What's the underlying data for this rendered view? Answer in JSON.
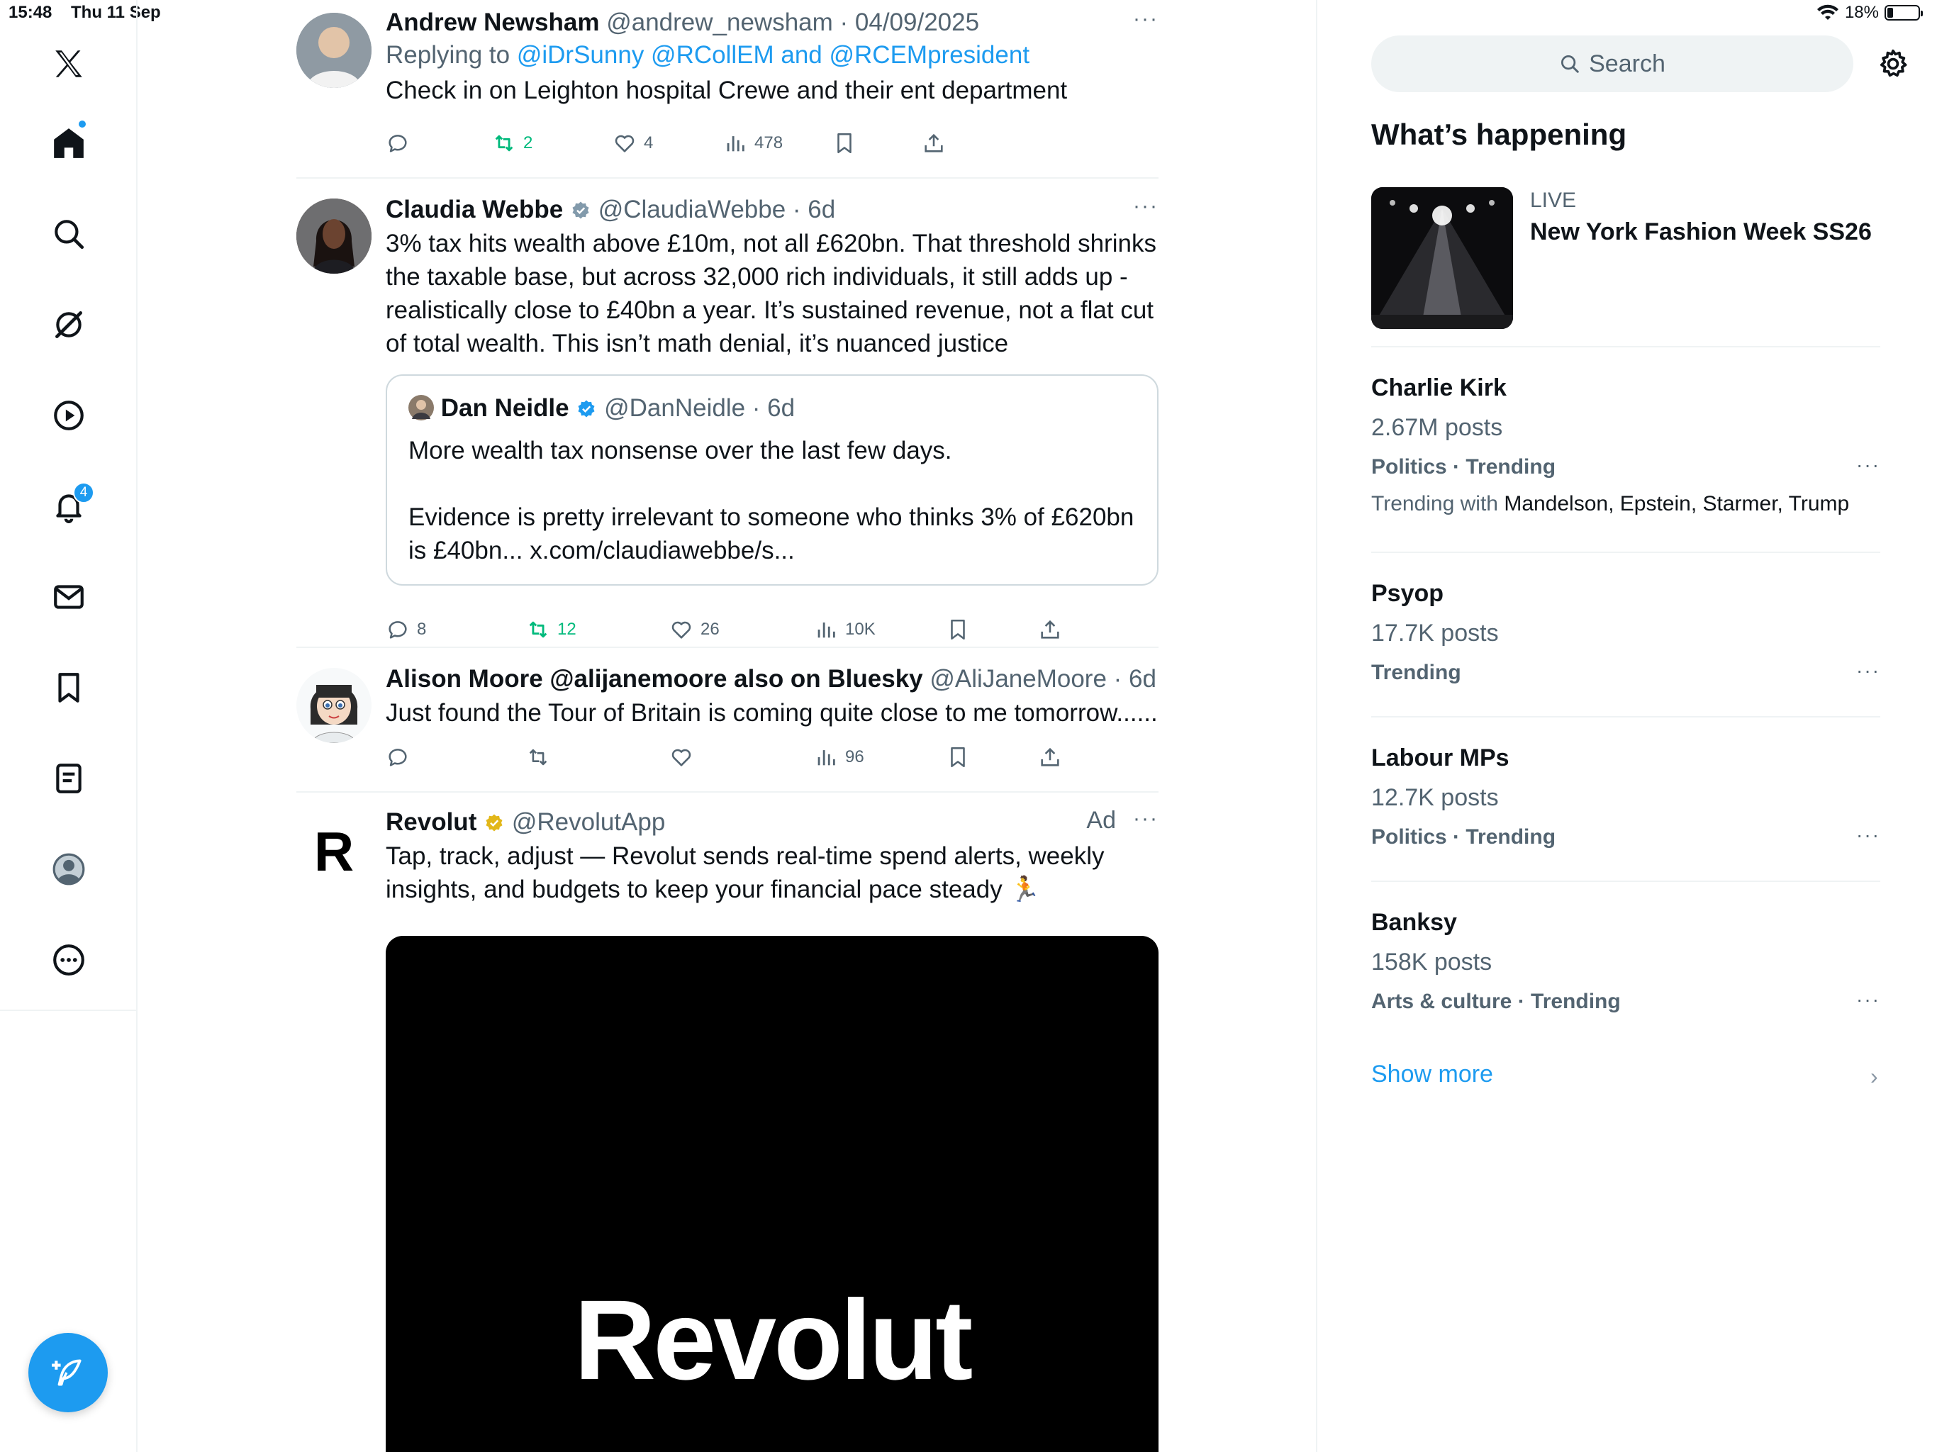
{
  "status_bar": {
    "time": "15:48",
    "date": "Thu 11 Sep",
    "battery": "18%",
    "battery_level": 0.18
  },
  "nav": {
    "notifications_badge": "4"
  },
  "tweets": [
    {
      "name": "Andrew Newsham",
      "handle": "@andrew_newsham",
      "date": "04/09/2025",
      "replying_prefix": "Replying to",
      "replying_to": "@iDrSunny @RCollEM and @RCEMpresident",
      "text": "Check in on Leighton hospital Crewe and their ent department",
      "replies": "",
      "retweets": "2",
      "likes": "4",
      "views": "478"
    },
    {
      "name": "Claudia Webbe",
      "handle": "@ClaudiaWebbe",
      "date": "6d",
      "text": "3% tax hits wealth above £10m, not all £620bn. That threshold shrinks the taxable base, but across 32,000 rich individuals, it still adds up - realistically close to £40bn a year. It’s sustained revenue, not a flat cut of total wealth. This isn’t math denial, it’s nuanced justice",
      "quote": {
        "name": "Dan Neidle",
        "handle": "@DanNeidle",
        "date": "6d",
        "line1": "More wealth tax nonsense over the last few days.",
        "line2": "Evidence is pretty irrelevant to someone who thinks 3% of £620bn is £40bn... x.com/claudiawebbe/s..."
      },
      "replies": "8",
      "retweets": "12",
      "likes": "26",
      "views": "10K"
    },
    {
      "name": "Alison Moore @alijanemoore also on Bluesky",
      "handle": "@AliJaneMoore",
      "date": "6d",
      "text": "Just found the Tour of Britain is coming quite close to me tomorrow......",
      "views": "96"
    },
    {
      "name": "Revolut",
      "handle": "@RevolutApp",
      "ad_label": "Ad",
      "text": "Tap, track, adjust — Revolut sends real-time spend alerts, weekly insights, and budgets to keep your financial pace steady 🏃",
      "media_logo": "Revolut"
    }
  ],
  "sidebar": {
    "search_placeholder": "Search",
    "section_title": "What’s happening",
    "live": {
      "label": "LIVE",
      "title": "New York Fashion Week SS26"
    },
    "trends": [
      {
        "name": "Charlie Kirk",
        "count": "2.67M posts",
        "category": "Politics · Trending",
        "with_prefix": "Trending with",
        "with": "Mandelson, Epstein, Starmer, Trump"
      },
      {
        "name": "Psyop",
        "count": "17.7K posts",
        "category": "Trending"
      },
      {
        "name": "Labour MPs",
        "count": "12.7K posts",
        "category": "Politics · Trending"
      },
      {
        "name": "Banksy",
        "count": "158K posts",
        "category": "Arts & culture · Trending"
      }
    ],
    "show_more": "Show more"
  }
}
